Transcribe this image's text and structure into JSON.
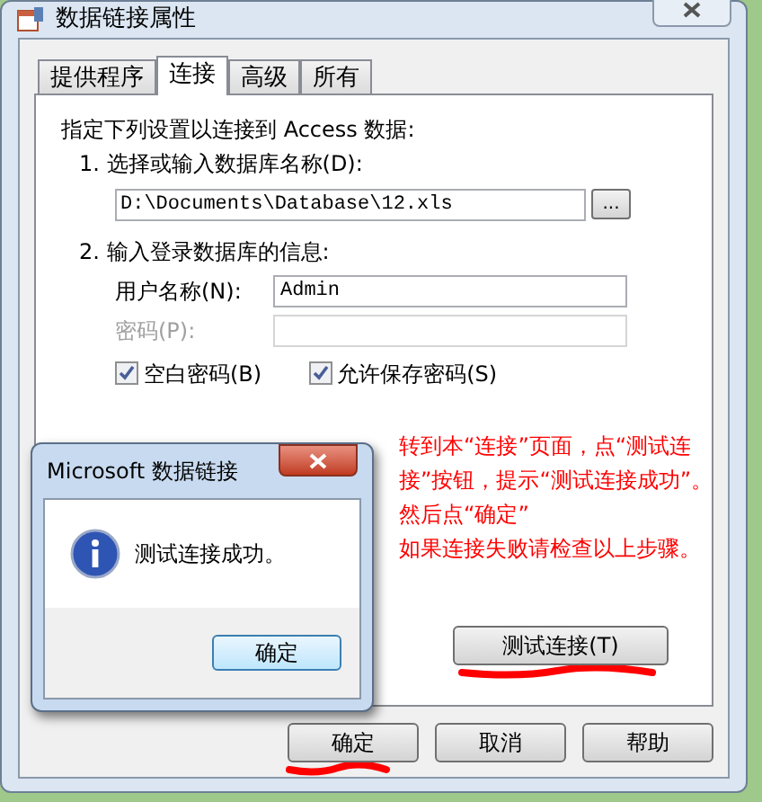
{
  "window": {
    "title": "数据链接属性"
  },
  "tabs": [
    {
      "label": "提供程序",
      "selected": false
    },
    {
      "label": "连接",
      "selected": true
    },
    {
      "label": "高级",
      "selected": false
    },
    {
      "label": "所有",
      "selected": false
    }
  ],
  "intro": "指定下列设置以连接到 Access 数据:",
  "step1": {
    "label": "1. 选择或输入数据库名称(D):",
    "value": "D:\\Documents\\Database\\12.xls",
    "browse": "..."
  },
  "step2": {
    "label": "2. 输入登录数据库的信息:",
    "fields": [
      {
        "label": "用户名称(N):",
        "value": "Admin",
        "disabled": false
      },
      {
        "label": "密码(P):",
        "disabled": true
      }
    ],
    "checkboxes": [
      {
        "label": "空白密码(B)",
        "checked": true
      },
      {
        "label": "允许保存密码(S)",
        "checked": true
      }
    ]
  },
  "annotation": [
    "转到本“连接”页面，点“测试连接”按钮，提示“测试连接成功”。然后点“确定”",
    "如果连接失败请检查以上步骤。"
  ],
  "test_button": "测试连接(T)",
  "buttons": [
    "确定",
    "取消",
    "帮助"
  ],
  "message_box": {
    "title": "Microsoft 数据链接",
    "message": "测试连接成功。",
    "button": "确定"
  }
}
